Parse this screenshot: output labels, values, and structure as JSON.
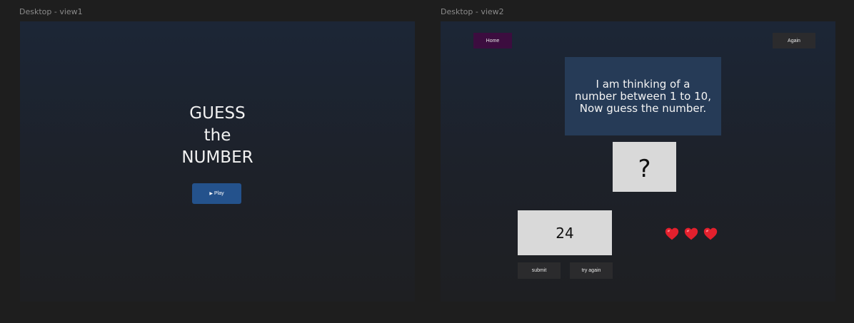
{
  "frames": {
    "view1": {
      "label": "Desktop - view1",
      "title_line1": "GUESS",
      "title_line2": "the",
      "title_line3": "NUMBER",
      "play_label": "Play"
    },
    "view2": {
      "label": "Desktop - view2",
      "home_label": "Home",
      "again_label": "Again",
      "message": "I am thinking of a number between 1 to 10, Now guess the number.",
      "secret_display": "?",
      "guess_value": "24",
      "submit_label": "submit",
      "try_again_label": "try again",
      "lives": 3
    }
  },
  "colors": {
    "canvas": "#1e1e1e",
    "play_button": "#24528c",
    "home_button": "#3c0d3f",
    "message_box": "#263b57",
    "heart": "#e3202d"
  }
}
